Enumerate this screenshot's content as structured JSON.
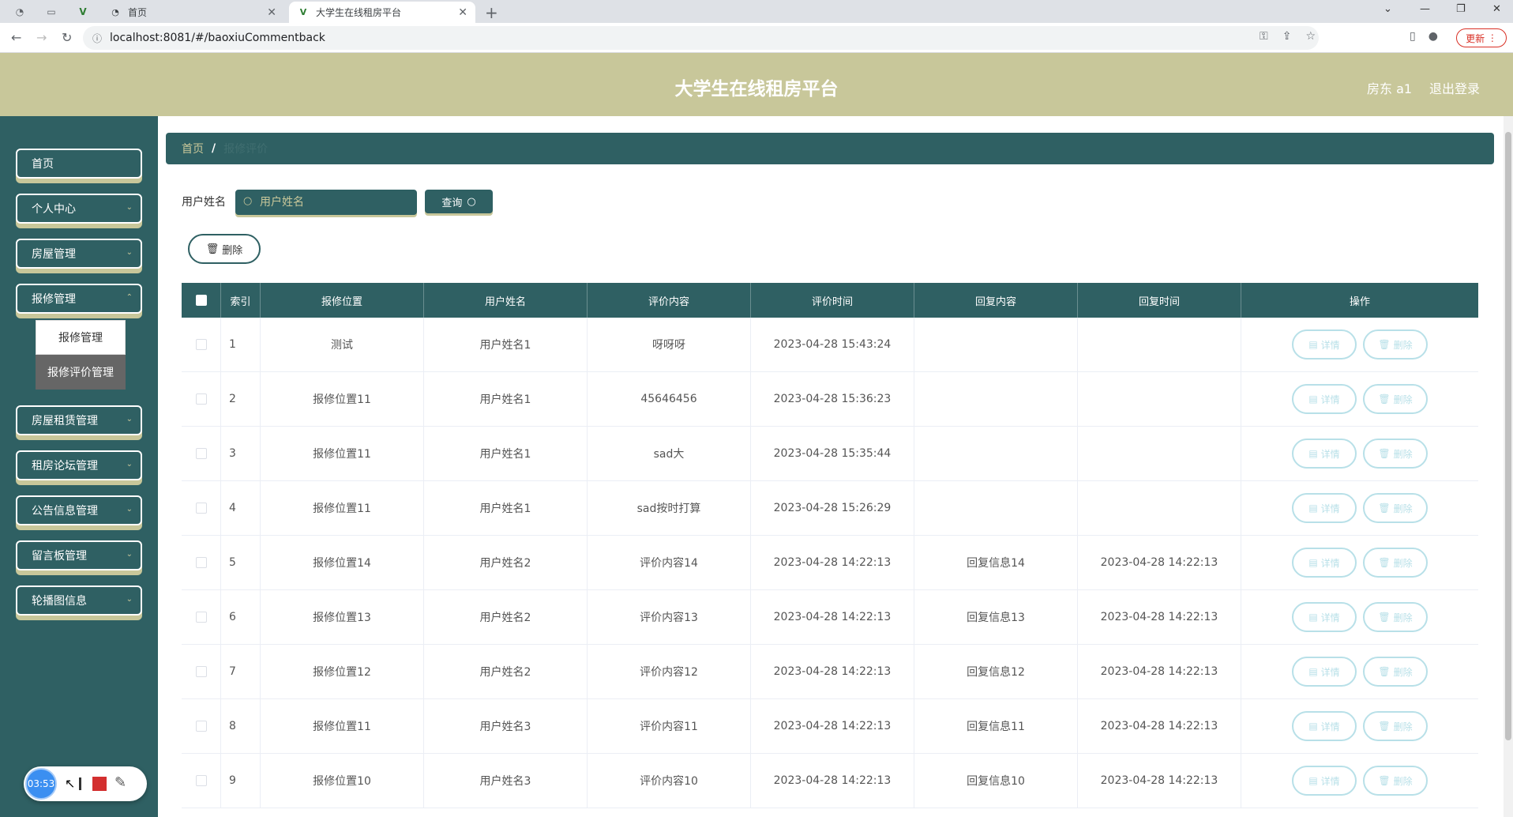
{
  "browser": {
    "tabs": [
      {
        "title": "首页",
        "active": false
      },
      {
        "title": "大学生在线租房平台",
        "active": true
      }
    ],
    "url": "localhost:8081/#/baoxiuCommentback",
    "update_label": "更新"
  },
  "header": {
    "title": "大学生在线租房平台",
    "user": "房东 a1",
    "logout": "退出登录"
  },
  "sidebar": {
    "items": [
      {
        "label": "首页",
        "has_chevron": false
      },
      {
        "label": "个人中心",
        "has_chevron": true
      },
      {
        "label": "房屋管理",
        "has_chevron": true
      },
      {
        "label": "报修管理",
        "has_chevron": true
      },
      {
        "label": "房屋租赁管理",
        "has_chevron": true
      },
      {
        "label": "租房论坛管理",
        "has_chevron": true
      },
      {
        "label": "公告信息管理",
        "has_chevron": true
      },
      {
        "label": "留言板管理",
        "has_chevron": true
      },
      {
        "label": "轮播图信息",
        "has_chevron": true
      }
    ],
    "submenu": [
      "报修管理",
      "报修评价管理"
    ]
  },
  "recorder": {
    "time": "03:53"
  },
  "breadcrumb": {
    "home": "首页",
    "sep": "/",
    "current": "报修评价"
  },
  "search": {
    "label": "用户姓名",
    "placeholder": "用户姓名",
    "button": "查询"
  },
  "toolbar": {
    "delete_label": "删除"
  },
  "table": {
    "headers": [
      "",
      "索引",
      "报修位置",
      "用户姓名",
      "评价内容",
      "评价时间",
      "回复内容",
      "回复时间",
      "操作"
    ],
    "actions": {
      "detail": "详情",
      "delete": "删除"
    },
    "rows": [
      {
        "idx": "1",
        "location": "测试",
        "user": "用户姓名1",
        "content": "呀呀呀",
        "time": "2023-04-28 15:43:24",
        "reply": "",
        "reply_time": ""
      },
      {
        "idx": "2",
        "location": "报修位置11",
        "user": "用户姓名1",
        "content": "45646456",
        "time": "2023-04-28 15:36:23",
        "reply": "",
        "reply_time": ""
      },
      {
        "idx": "3",
        "location": "报修位置11",
        "user": "用户姓名1",
        "content": "sad大",
        "time": "2023-04-28 15:35:44",
        "reply": "",
        "reply_time": ""
      },
      {
        "idx": "4",
        "location": "报修位置11",
        "user": "用户姓名1",
        "content": "sad按时打算",
        "time": "2023-04-28 15:26:29",
        "reply": "",
        "reply_time": ""
      },
      {
        "idx": "5",
        "location": "报修位置14",
        "user": "用户姓名2",
        "content": "评价内容14",
        "time": "2023-04-28 14:22:13",
        "reply": "回复信息14",
        "reply_time": "2023-04-28 14:22:13"
      },
      {
        "idx": "6",
        "location": "报修位置13",
        "user": "用户姓名2",
        "content": "评价内容13",
        "time": "2023-04-28 14:22:13",
        "reply": "回复信息13",
        "reply_time": "2023-04-28 14:22:13"
      },
      {
        "idx": "7",
        "location": "报修位置12",
        "user": "用户姓名2",
        "content": "评价内容12",
        "time": "2023-04-28 14:22:13",
        "reply": "回复信息12",
        "reply_time": "2023-04-28 14:22:13"
      },
      {
        "idx": "8",
        "location": "报修位置11",
        "user": "用户姓名3",
        "content": "评价内容11",
        "time": "2023-04-28 14:22:13",
        "reply": "回复信息11",
        "reply_time": "2023-04-28 14:22:13"
      },
      {
        "idx": "9",
        "location": "报修位置10",
        "user": "用户姓名3",
        "content": "评价内容10",
        "time": "2023-04-28 14:22:13",
        "reply": "回复信息10",
        "reply_time": "2023-04-28 14:22:13"
      }
    ]
  },
  "colors": {
    "primary": "#2f6063",
    "accent": "#c8c79a",
    "action_outline": "#b8e0e8"
  }
}
